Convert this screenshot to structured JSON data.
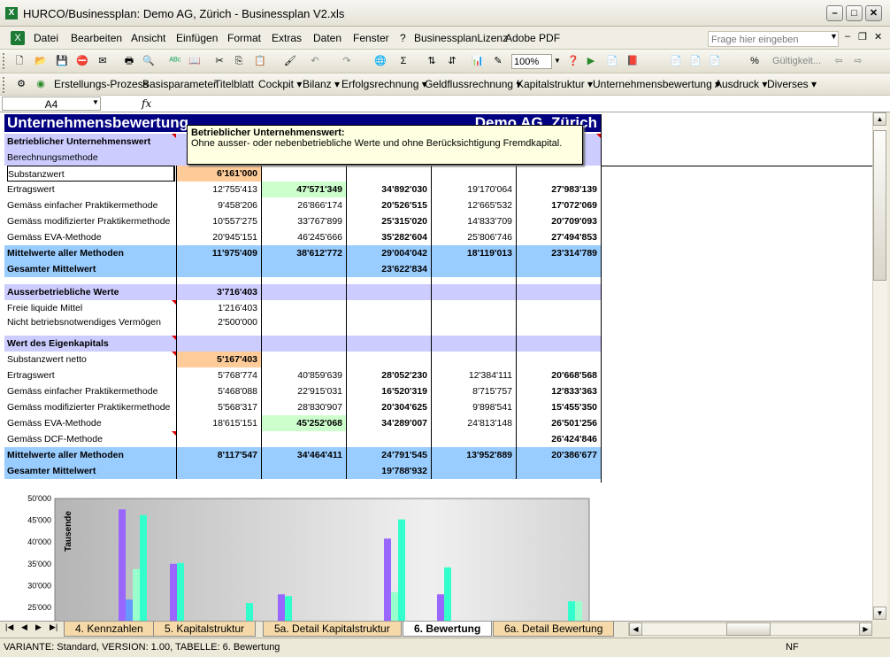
{
  "window": {
    "title": "HURCO/Businessplan: Demo AG, Zürich - Businessplan V2.xls"
  },
  "menu": [
    "Datei",
    "Bearbeiten",
    "Ansicht",
    "Einfügen",
    "Format",
    "Extras",
    "Daten",
    "Fenster",
    "?",
    "BusinessplanLizenz",
    "Adobe PDF"
  ],
  "ask_placeholder": "Frage hier eingeben",
  "toolbar": {
    "zoom": "100%",
    "gueltigkeit": "Gültigkeit..."
  },
  "commandbar": [
    "Erstellungs-Prozess",
    "Basisparameter",
    "Titelblatt",
    "Cockpit ▾",
    "Bilanz ▾",
    "Erfolgsrechnung ▾",
    "Geldflussrechnung ▾",
    "Kapitalstruktur ▾",
    "Unternehmensbewertung ▾",
    "Ausdruck ▾",
    "Diverses ▾"
  ],
  "formula": {
    "namebox": "A4",
    "fx": "fx",
    "value": ""
  },
  "sheet": {
    "header_title": "Unternehmensbewertung",
    "header_company": "Demo AG, Zürich",
    "section1_label": "Betrieblicher Unternehmenswert",
    "section1_sub": "Berechnungsmethode",
    "rows1": [
      {
        "label": "Substanzwert",
        "v": [
          "6'161'000",
          "",
          "",
          "",
          ""
        ]
      },
      {
        "label": "Ertragswert",
        "v": [
          "12'755'413",
          "47'571'349",
          "34'892'030",
          "19'170'064",
          "27'983'139"
        ]
      },
      {
        "label": "Gemäss einfacher Praktikermethode",
        "v": [
          "9'458'206",
          "26'866'174",
          "20'526'515",
          "12'665'532",
          "17'072'069"
        ]
      },
      {
        "label": "Gemäss modifizierter Praktikermethode",
        "v": [
          "10'557'275",
          "33'767'899",
          "25'315'020",
          "14'833'709",
          "20'709'093"
        ]
      },
      {
        "label": "Gemäss EVA-Methode",
        "v": [
          "20'945'151",
          "46'245'666",
          "35'282'604",
          "25'806'746",
          "27'494'853"
        ]
      }
    ],
    "mittel1": {
      "label": "Mittelwerte aller Methoden",
      "v": [
        "11'975'409",
        "38'612'772",
        "29'004'042",
        "18'119'013",
        "23'314'789"
      ]
    },
    "gesamt1": {
      "label": "Gesamter Mittelwert",
      "v": "23'622'834"
    },
    "ausser": {
      "label": "Ausserbetriebliche Werte",
      "v": "3'716'403"
    },
    "ausser_rows": [
      {
        "label": "Freie liquide Mittel",
        "v": "1'216'403"
      },
      {
        "label": "Nicht betriebsnotwendiges Vermögen",
        "v": "2'500'000"
      }
    ],
    "ek_label": "Wert des Eigenkapitals",
    "rows2": [
      {
        "label": "Substanzwert netto",
        "v": [
          "5'167'403",
          "",
          "",
          "",
          ""
        ]
      },
      {
        "label": "Ertragswert",
        "v": [
          "5'768'774",
          "40'859'639",
          "28'052'230",
          "12'384'111",
          "20'668'568"
        ]
      },
      {
        "label": "Gemäss einfacher Praktikermethode",
        "v": [
          "5'468'088",
          "22'915'031",
          "16'520'319",
          "8'715'757",
          "12'833'363"
        ]
      },
      {
        "label": "Gemäss modifizierter Praktikermethode",
        "v": [
          "5'568'317",
          "28'830'907",
          "20'304'625",
          "9'898'541",
          "15'455'350"
        ]
      },
      {
        "label": "Gemäss EVA-Methode",
        "v": [
          "18'615'151",
          "45'252'068",
          "34'289'007",
          "24'813'148",
          "26'501'256"
        ]
      },
      {
        "label": "Gemäss DCF-Methode",
        "v": [
          "",
          "",
          "",
          "",
          "26'424'846"
        ]
      }
    ],
    "mittel2": {
      "label": "Mittelwerte aller Methoden",
      "v": [
        "8'117'547",
        "34'464'411",
        "24'791'545",
        "13'952'889",
        "20'386'677"
      ]
    },
    "gesamt2": {
      "label": "Gesamter Mittelwert",
      "v": "19'788'932"
    }
  },
  "tooltip": {
    "title": "Betrieblicher Unternehmenswert:",
    "text": "Ohne ausser- oder nebenbetriebliche Werte und ohne Berücksichtigung Fremdkapital."
  },
  "chart_data": {
    "type": "bar",
    "ylabel": "Tausende",
    "y_ticks": [
      "50'000",
      "45'000",
      "40'000",
      "35'000",
      "30'000",
      "25'000"
    ],
    "ylim_visible": [
      25000,
      50000
    ],
    "groups": [
      {
        "bars": [
          {
            "color": "#9966ff",
            "value": 47500
          },
          {
            "color": "#6699ff",
            "value": 26800
          },
          {
            "color": "#99ffcc",
            "value": 33800
          },
          {
            "color": "#33ffcc",
            "value": 46200
          }
        ]
      },
      {
        "bars": [
          {
            "color": "#9966ff",
            "value": 35000
          },
          {
            "color": "#33ffcc",
            "value": 35200
          }
        ]
      },
      {
        "bars": [
          {
            "color": "#33ffcc",
            "value": 26000
          }
        ]
      },
      {
        "bars": [
          {
            "color": "#9966ff",
            "value": 28000
          },
          {
            "color": "#33ffcc",
            "value": 27600
          }
        ]
      },
      {
        "bars": [
          {
            "color": "#9966ff",
            "value": 40800
          },
          {
            "color": "#99ffcc",
            "value": 28500
          },
          {
            "color": "#33ffcc",
            "value": 45200
          }
        ]
      },
      {
        "bars": [
          {
            "color": "#9966ff",
            "value": 28000
          },
          {
            "color": "#33ffcc",
            "value": 34200
          }
        ]
      },
      {
        "bars": [
          {
            "color": "#33ffcc",
            "value": 26400
          },
          {
            "color": "#99ffcc",
            "value": 26400
          }
        ]
      }
    ]
  },
  "tabs": [
    "4. Kennzahlen",
    "5. Kapitalstruktur",
    "5a. Detail Kapitalstruktur",
    "6. Bewertung",
    "6a. Detail Bewertung"
  ],
  "active_tab": 3,
  "status": {
    "left": "VARIANTE: Standard, VERSION: 1.00, TABELLE: 6. Bewertung",
    "right": "NF"
  }
}
